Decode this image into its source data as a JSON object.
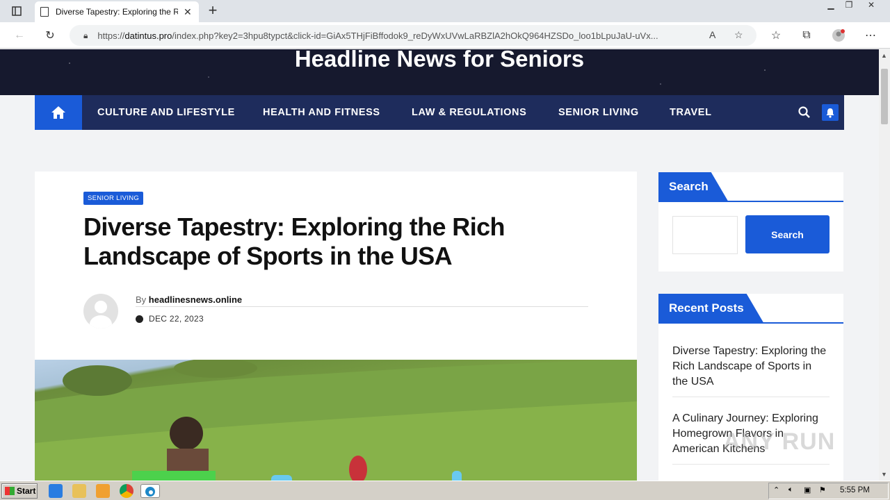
{
  "browser": {
    "tab_title": "Diverse Tapestry: Exploring the Rich Landscape of Sports in the USA",
    "url_prefix": "https://",
    "url_host": "datintus.pro",
    "url_rest": "/index.php?key2=3hpu8typct&click-id=GiAx5THjFiBffodok9_reDyWxUVwLaRBZlA2hOkQ964HZSDo_loo1bLpuJaU-uVx..."
  },
  "site": {
    "title": "Headline News for Seniors",
    "nav": [
      "CULTURE AND LIFESTYLE",
      "HEALTH AND FITNESS",
      "LAW & REGULATIONS",
      "SENIOR LIVING",
      "TRAVEL"
    ]
  },
  "article": {
    "category": "SENIOR LIVING",
    "title": "Diverse Tapestry: Exploring the Rich Landscape of Sports in the USA",
    "by_label": "By",
    "author": "headlinesnews.online",
    "date": "DEC 22, 2023"
  },
  "sidebar": {
    "search_title": "Search",
    "search_button": "Search",
    "recent_title": "Recent Posts",
    "recent": [
      "Diverse Tapestry: Exploring the Rich Landscape of Sports in the USA",
      "A Culinary Journey: Exploring Homegrown Flavors in American Kitchens"
    ]
  },
  "watermark": "ANY RUN",
  "taskbar": {
    "start_label": "Start",
    "clock": "5:55 PM"
  },
  "colors": {
    "accent": "#1a5bd8",
    "nav_bg": "#1e2c5c",
    "header_bg": "#16192e"
  }
}
